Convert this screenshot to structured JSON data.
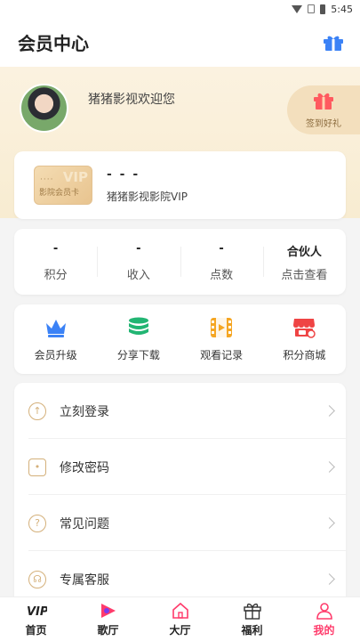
{
  "status_bar": {
    "time": "5:45"
  },
  "header": {
    "title": "会员中心"
  },
  "profile": {
    "welcome": "猪猪影视欢迎您",
    "checkin_label": "签到好礼"
  },
  "vip_card": {
    "badge_vip": "VIP",
    "badge_text": "影院会员卡",
    "badge_dots": "····",
    "name": "- - -",
    "description": "猪猪影视影院VIP"
  },
  "stats": [
    {
      "value": "-",
      "label": "积分"
    },
    {
      "value": "-",
      "label": "收入"
    },
    {
      "value": "-",
      "label": "点数"
    },
    {
      "value": "合伙人",
      "label": "点击查看"
    }
  ],
  "quick_actions": [
    {
      "label": "会员升级",
      "icon": "crown-icon"
    },
    {
      "label": "分享下载",
      "icon": "database-icon"
    },
    {
      "label": "观看记录",
      "icon": "film-icon"
    },
    {
      "label": "积分商城",
      "icon": "shop-icon"
    }
  ],
  "menu": [
    {
      "label": "立刻登录",
      "icon": "login-icon"
    },
    {
      "label": "修改密码",
      "icon": "lock-icon"
    },
    {
      "label": "常见问题",
      "icon": "question-icon"
    },
    {
      "label": "专属客服",
      "icon": "headset-icon"
    }
  ],
  "tabs": [
    {
      "label": "首页",
      "icon": "vip-logo-icon"
    },
    {
      "label": "歌厅",
      "icon": "music-icon"
    },
    {
      "label": "大厅",
      "icon": "home-icon"
    },
    {
      "label": "福利",
      "icon": "gift-icon"
    },
    {
      "label": "我的",
      "icon": "user-icon",
      "active": true
    }
  ],
  "colors": {
    "accent": "#ff3b6b",
    "gold": "#d4b07a",
    "hero_bg": "#f8ecd1",
    "crown": "#3b82f6",
    "green": "#22b573",
    "orange": "#f5a623",
    "red": "#ef4444"
  }
}
